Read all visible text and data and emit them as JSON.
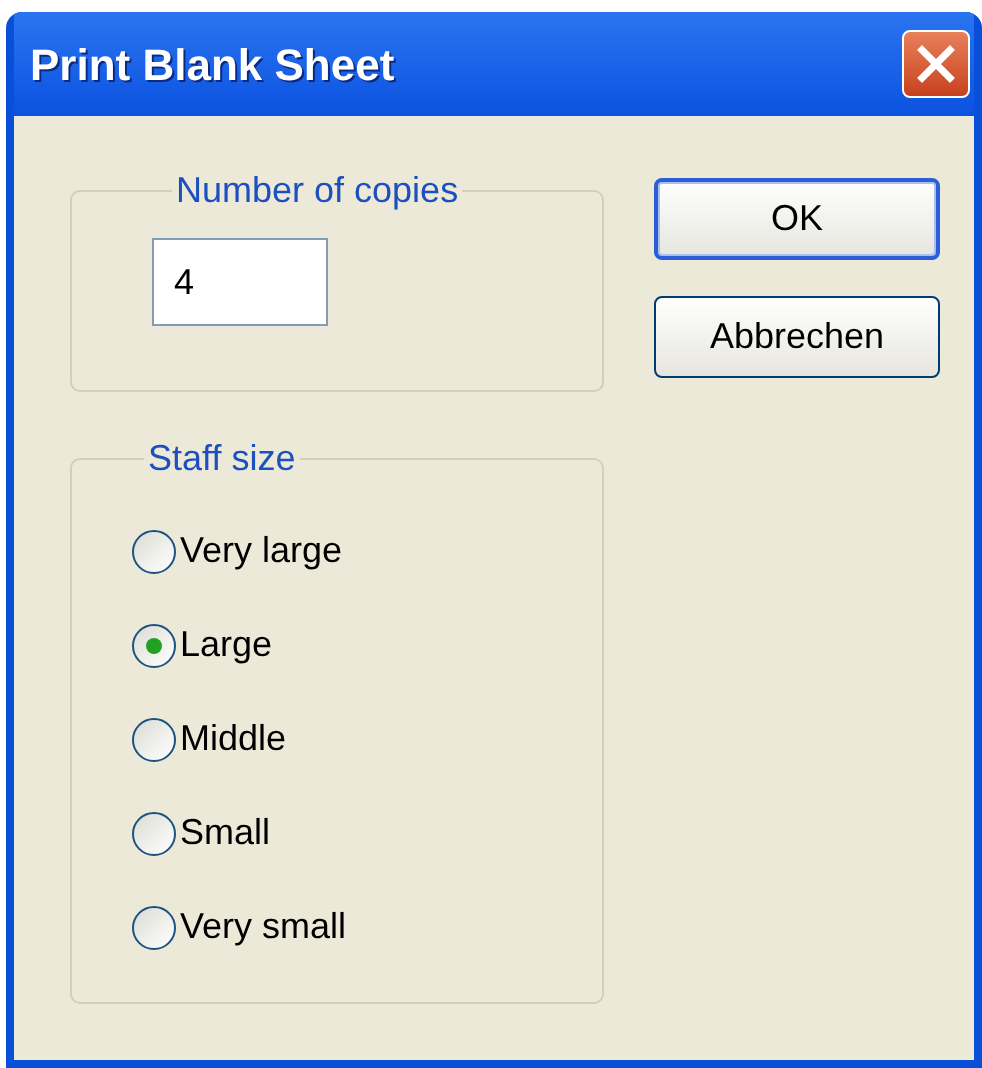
{
  "window": {
    "title": "Print Blank Sheet"
  },
  "copies_group": {
    "label": "Number of copies",
    "value": "4"
  },
  "buttons": [
    {
      "label": "OK",
      "default": true
    },
    {
      "label": "Abbrechen",
      "default": false
    }
  ],
  "staff_size": {
    "label": "Staff size",
    "options": [
      {
        "label": "Very large",
        "selected": false
      },
      {
        "label": "Large",
        "selected": true
      },
      {
        "label": "Middle",
        "selected": false
      },
      {
        "label": "Small",
        "selected": false
      },
      {
        "label": "Very small",
        "selected": false
      }
    ]
  }
}
